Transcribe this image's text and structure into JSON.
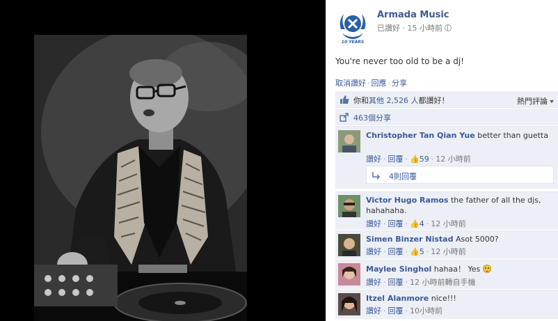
{
  "page": {
    "name": "Armada Music",
    "liked_label": "已讚好",
    "time": "15 小時前",
    "logo_text": "10 YEARS"
  },
  "post": {
    "text": "You're never too old to be a dj!",
    "actions": [
      "取消讚好",
      "回應",
      "分享"
    ]
  },
  "likes_bar": {
    "prefix": "你和",
    "others_link": "其他 2,526 人",
    "suffix": "都讚好！",
    "sort_label": "熱門評論"
  },
  "shares": {
    "text": "463個分享"
  },
  "comments": [
    {
      "author": "Christopher Tan Qian Yue",
      "text": "better than guetta",
      "like_label": "讚好",
      "reply_label": "回覆",
      "likes": "59",
      "time": "12 小時前",
      "replies": "4則回覆"
    },
    {
      "author": "Victor Hugo Ramos",
      "text": "the father of all the djs, hahahaha.",
      "like_label": "讚好",
      "reply_label": "回覆",
      "likes": "4",
      "time": "12 小時前"
    },
    {
      "author": "Simen Binzer Nistad",
      "text": "Asot 5000?",
      "like_label": "讚好",
      "reply_label": "回覆",
      "likes": "5",
      "time": "12 小時前"
    },
    {
      "author": "Maylee Singhol",
      "text": "hahaa！ Yes",
      "like_label": "讚好",
      "reply_label": "回覆",
      "time": "12 小時前轉自手機"
    },
    {
      "author": "Itzel Alanmore",
      "text": "nice!!!",
      "like_label": "讚好",
      "reply_label": "回覆",
      "time": "10小時前"
    }
  ],
  "colors": {
    "link": "#3b5998",
    "panel_bg": "#ffffff",
    "comment_bg": "#eceff5",
    "viewer_bg": "#000000"
  }
}
